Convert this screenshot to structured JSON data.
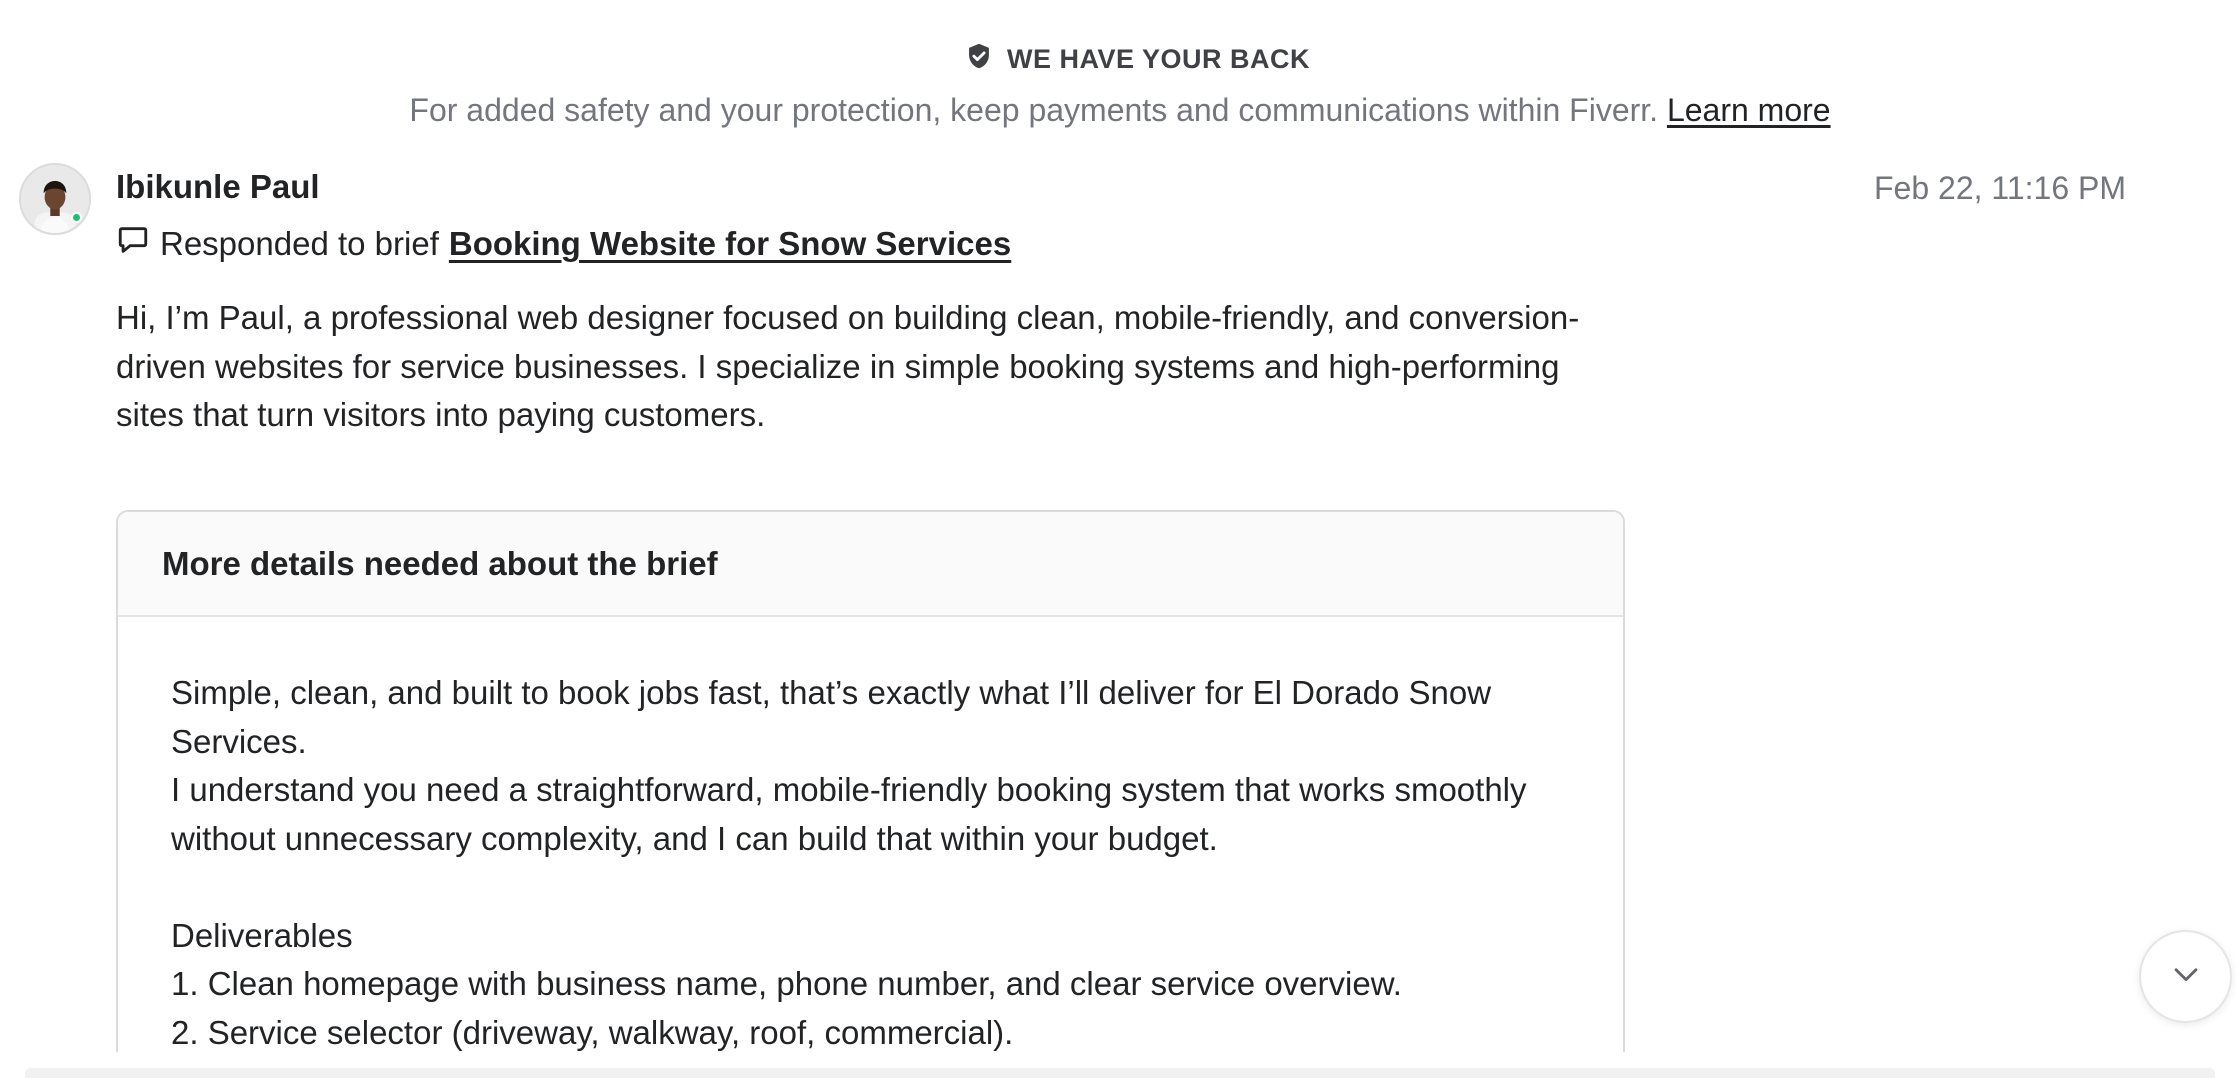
{
  "banner": {
    "title": "WE HAVE YOUR BACK",
    "text": "For added safety and your protection, keep payments and communications within Fiverr.",
    "link": "Learn more",
    "icon": "shield-check-icon"
  },
  "message": {
    "sender": "Ibikunle Paul",
    "timestamp": "Feb 22, 11:16 PM",
    "online_status_color": "#1dbf73",
    "brief_prefix": "Responded to brief",
    "brief_link": "Booking Website for Snow Services",
    "intro_lines": [
      "Hi, I’m Paul, a professional web designer focused on building clean, mobile-friendly, and conversion-",
      "driven websites for service businesses. I specialize in simple booking systems and high-performing",
      "sites that turn visitors into paying customers."
    ]
  },
  "details_card": {
    "title": "More details needed about the brief",
    "lines": [
      "Simple, clean, and built to book jobs fast,  that’s exactly what I’ll deliver for El Dorado Snow",
      "Services.",
      "I understand you need a straightforward, mobile-friendly booking system that works smoothly",
      "without unnecessary complexity,  and I can build that within your budget.",
      "",
      "Deliverables",
      "1. Clean homepage with business name, phone number, and clear service overview.",
      "2. Service selector (driveway, walkway, roof, commercial)."
    ]
  },
  "scroll_button": {
    "icon": "chevron-down-icon"
  }
}
